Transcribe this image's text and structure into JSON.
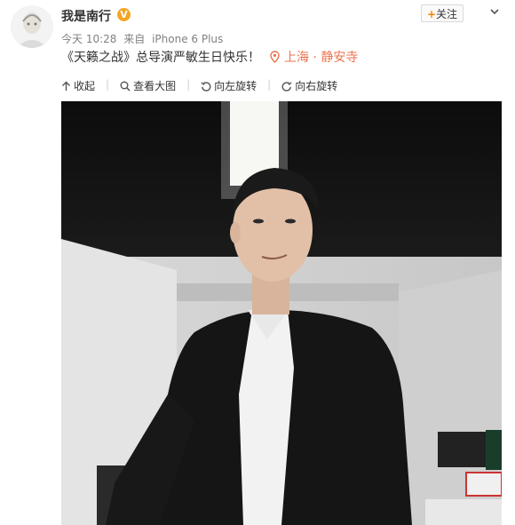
{
  "post": {
    "username": "我是南行",
    "vip_badge": "V",
    "time": "今天 10:28",
    "source_prefix": "来自",
    "source_device": "iPhone 6 Plus",
    "text": "《天籁之战》总导演严敏生日快乐！",
    "location": "上海 · 静安寺"
  },
  "actions": {
    "follow_plus": "+",
    "follow_label": "关注"
  },
  "toolbar": {
    "collapse": "收起",
    "view_large": "查看大图",
    "rotate_left": "向左旋转",
    "rotate_right": "向右旋转"
  },
  "colors": {
    "accent": "#ff8200",
    "location": "#eb7350",
    "meta": "#808080"
  }
}
